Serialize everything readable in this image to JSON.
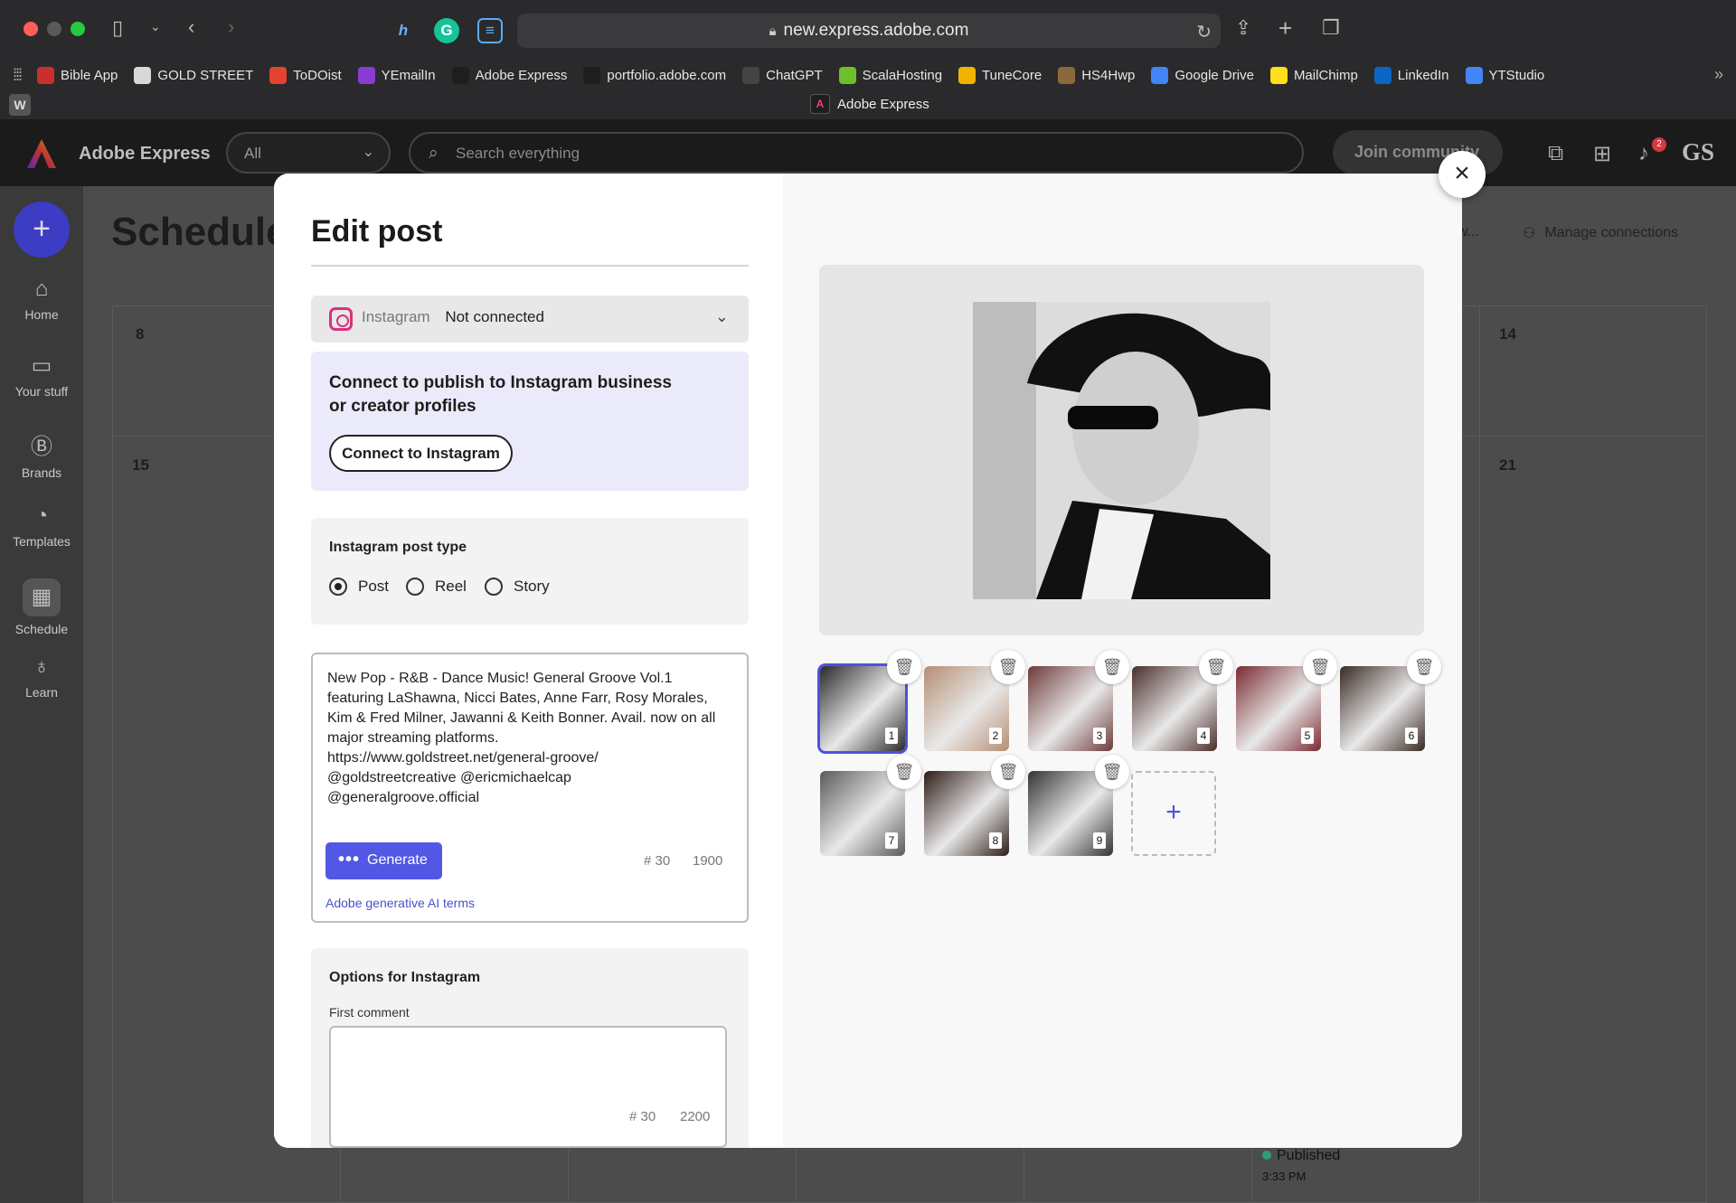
{
  "browser": {
    "url": "new.express.adobe.com",
    "tab_title": "Adobe Express",
    "bookmarks": [
      {
        "label": "Bible App",
        "color": "#c9302c"
      },
      {
        "label": "GOLD STREET",
        "color": "#d8d8d8"
      },
      {
        "label": "ToDOist",
        "color": "#e44332"
      },
      {
        "label": "YEmailIn",
        "color": "#8a3bd1"
      },
      {
        "label": "Adobe Express",
        "color": "#1e1e1e"
      },
      {
        "label": "portfolio.adobe.com",
        "color": "#1e1e1e"
      },
      {
        "label": "ChatGPT",
        "color": "#444"
      },
      {
        "label": "ScalaHosting",
        "color": "#6fbf2c"
      },
      {
        "label": "TuneCore",
        "color": "#f0b400"
      },
      {
        "label": "HS4Hwp",
        "color": "#8a6a3d"
      },
      {
        "label": "Google Drive",
        "color": "#4285f4"
      },
      {
        "label": "MailChimp",
        "color": "#ffe01b"
      },
      {
        "label": "LinkedIn",
        "color": "#0a66c2"
      },
      {
        "label": "YTStudio",
        "color": "#4285f4"
      }
    ]
  },
  "app": {
    "name": "Adobe Express",
    "scope": "All",
    "search_placeholder": "Search everything",
    "join_label": "Join community",
    "notification_count": "2",
    "user_initials": "GS"
  },
  "rail": [
    {
      "label": "Home",
      "icon": "home-icon",
      "glyph": "⌂"
    },
    {
      "label": "Your stuff",
      "icon": "folder-icon",
      "glyph": "▭"
    },
    {
      "label": "Brands",
      "icon": "brand-icon",
      "glyph": "Ⓑ"
    },
    {
      "label": "Templates",
      "icon": "templates-icon",
      "glyph": "◔"
    },
    {
      "label": "Schedule",
      "icon": "calendar-icon",
      "glyph": "▦"
    },
    {
      "label": "Learn",
      "icon": "bulb-icon",
      "glyph": "♁"
    }
  ],
  "background": {
    "page_title": "Schedule",
    "manage_connections": "Manage connections",
    "overflow_text": "w...",
    "day_numbers": [
      "8",
      "14",
      "15",
      "21"
    ],
    "published_label": "Published",
    "published_time": "3:33 PM"
  },
  "modal": {
    "title": "Edit post",
    "platform": "Instagram",
    "connection_status": "Not connected",
    "connect_message": "Connect to publish to Instagram business or creator profiles",
    "connect_button": "Connect to Instagram",
    "post_type_label": "Instagram post type",
    "post_types": [
      {
        "label": "Post",
        "selected": true
      },
      {
        "label": "Reel",
        "selected": false
      },
      {
        "label": "Story",
        "selected": false
      }
    ],
    "caption": "New Pop - R&B - Dance Music! General Groove Vol.1\nfeaturing LaShawna, Nicci Bates, Anne Farr, Rosy Morales,\nKim & Fred Milner, Jawanni & Keith Bonner. Avail. now on all\nmajor streaming platforms.\nhttps://www.goldstreet.net/general-groove/\n@goldstreetcreative @ericmichaelcap\n@generalgroove.official",
    "generate_label": "Generate",
    "hashtag_count": "# 30",
    "char_limit": "1900",
    "ai_terms": "Adobe generative AI terms",
    "options_label": "Options for Instagram",
    "first_comment_label": "First comment",
    "first_comment_hashtags": "# 30",
    "first_comment_limit": "2200",
    "thumbnails": [
      {
        "n": "1",
        "selected": true,
        "tone": "#2a2a2a"
      },
      {
        "n": "2",
        "selected": false,
        "tone": "#b58e74"
      },
      {
        "n": "3",
        "selected": false,
        "tone": "#6d3a3a"
      },
      {
        "n": "4",
        "selected": false,
        "tone": "#4a2d2a"
      },
      {
        "n": "5",
        "selected": false,
        "tone": "#7a2a30"
      },
      {
        "n": "6",
        "selected": false,
        "tone": "#3a2a24"
      },
      {
        "n": "7",
        "selected": false,
        "tone": "#5a5a5a"
      },
      {
        "n": "8",
        "selected": false,
        "tone": "#2e1c16"
      },
      {
        "n": "9",
        "selected": false,
        "tone": "#333333"
      }
    ]
  }
}
